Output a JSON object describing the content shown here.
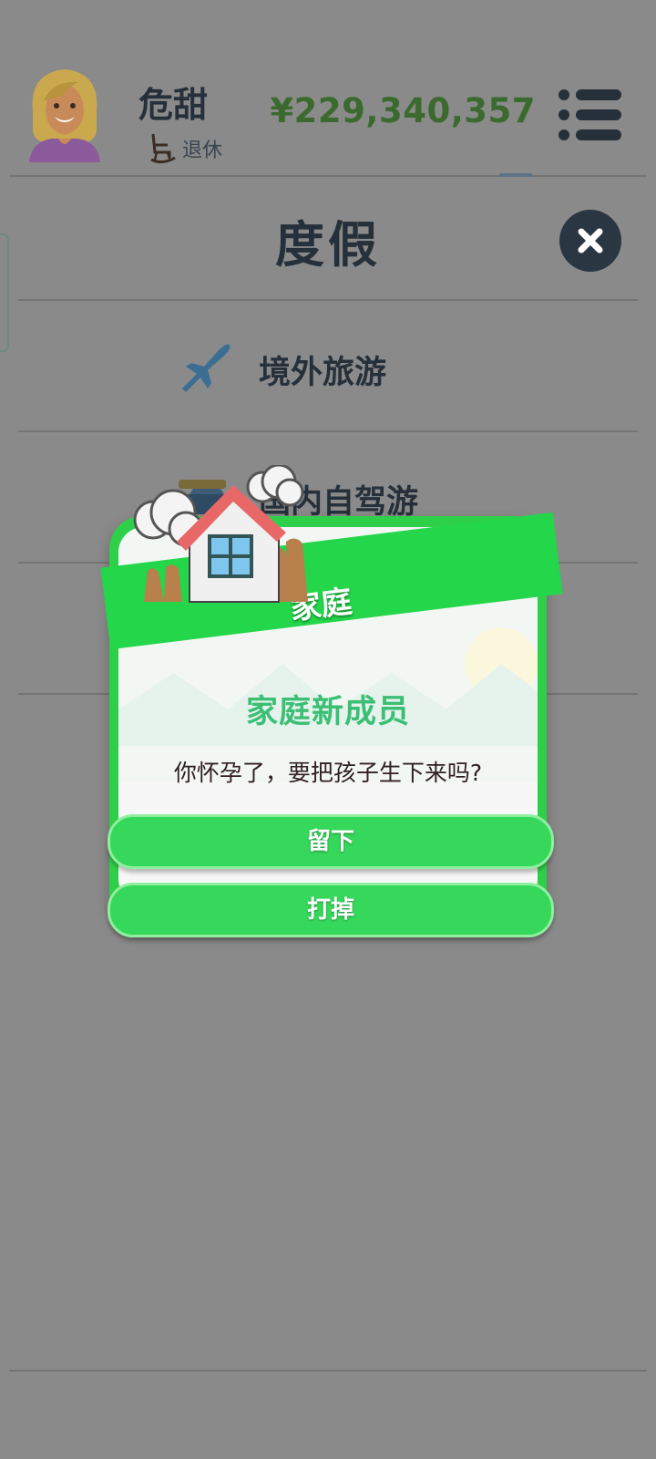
{
  "header": {
    "player_name": "危甜",
    "status": "退休",
    "money": "¥229,340,357",
    "avatar_icon": "avatar-blonde-woman",
    "status_icon": "rocking-chair-icon",
    "menu_icon": "hamburger-menu-icon"
  },
  "page": {
    "title": "度假",
    "close_icon": "close-icon",
    "options": [
      {
        "label": "境外旅游",
        "icon": "airplane-icon"
      },
      {
        "label": "国内自驾游",
        "icon": "car-icon"
      }
    ]
  },
  "dialog": {
    "category": "家庭",
    "title": "家庭新成员",
    "message": "你怀孕了，要把孩子生下来吗?",
    "buttons": {
      "keep": "留下",
      "abort": "打掉"
    },
    "illustration": "house-in-hands"
  },
  "colors": {
    "overlay": "#8a8a8a",
    "money": "#3b6a2e",
    "accent_green": "#2fd049",
    "dialog_title": "#3bbf74"
  }
}
